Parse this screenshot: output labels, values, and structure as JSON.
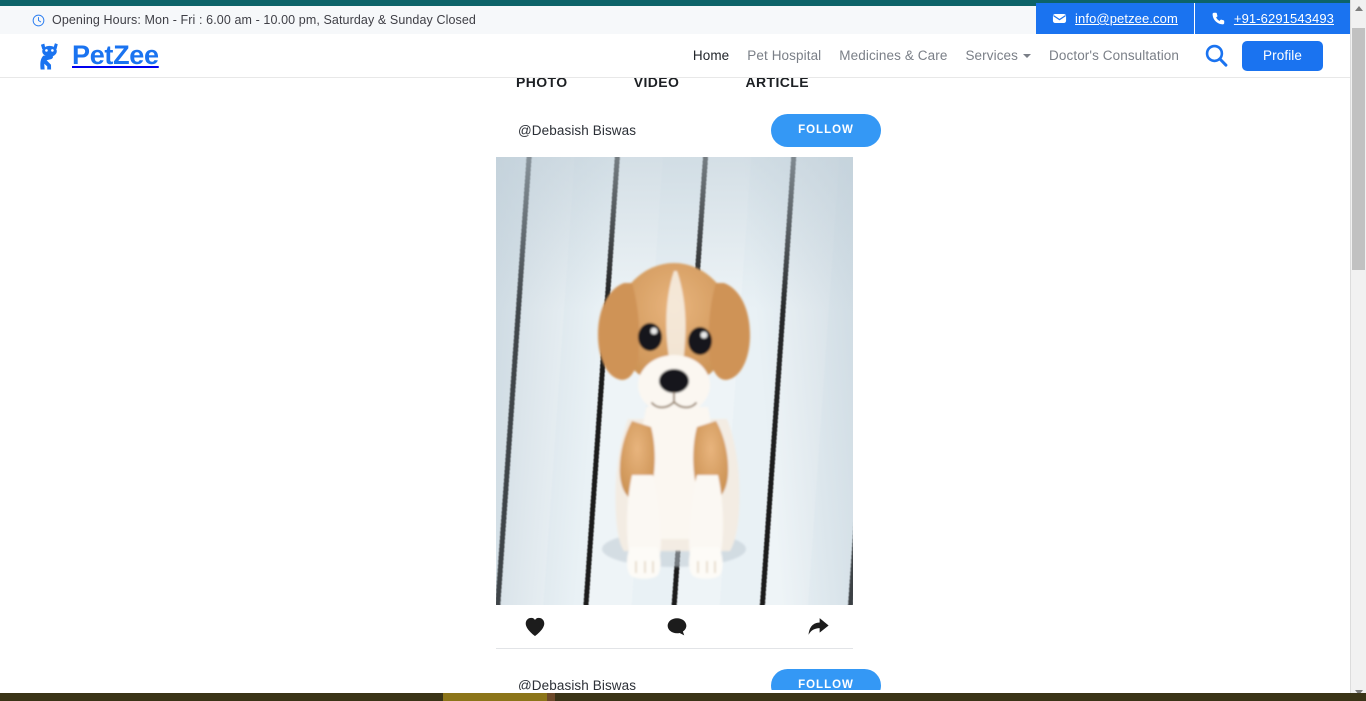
{
  "topbar": {
    "hours_text": "Opening Hours: Mon - Fri : 6.00 am - 10.00 pm, Saturday & Sunday Closed",
    "clock_icon": "clock-icon",
    "strip_color": "#0d6369"
  },
  "contact": {
    "email": "info@petzee.com",
    "phone": "+91-6291543493",
    "email_icon": "envelope-icon",
    "phone_icon": "phone-icon",
    "background_color": "#1a73f0"
  },
  "header": {
    "brand_name": "PetZee",
    "brand_icon": "cat-logo-icon",
    "brand_color": "#1a73f0",
    "search_icon": "search-icon",
    "profile_label": "Profile",
    "nav": [
      {
        "label": "Home",
        "active": true
      },
      {
        "label": "Pet Hospital",
        "active": false
      },
      {
        "label": "Medicines & Care",
        "active": false
      },
      {
        "label": "Services",
        "active": false,
        "caret": true
      },
      {
        "label": "Doctor's Consultation",
        "active": false
      }
    ]
  },
  "feed": {
    "tabs": [
      {
        "label": "PHOTO"
      },
      {
        "label": "VIDEO"
      },
      {
        "label": "ARTICLE"
      }
    ],
    "posts": [
      {
        "handle": "@Debasish Biswas",
        "follow_label": "FOLLOW",
        "image_alt": "puppy sitting on white wooden deck",
        "actions": [
          {
            "name": "like-icon",
            "glyph": "heart"
          },
          {
            "name": "comment-icon",
            "glyph": "speech-bubble"
          },
          {
            "name": "share-icon",
            "glyph": "arrow"
          }
        ]
      },
      {
        "handle": "@Debasish Biswas",
        "follow_label": "FOLLOW"
      }
    ],
    "follow_button_color": "#3498f5"
  },
  "scrollbar": {
    "up_arrow": "scroll-up-arrow-icon",
    "down_arrow": "scroll-down-arrow-icon",
    "thumb": "scrollbar-thumb"
  }
}
